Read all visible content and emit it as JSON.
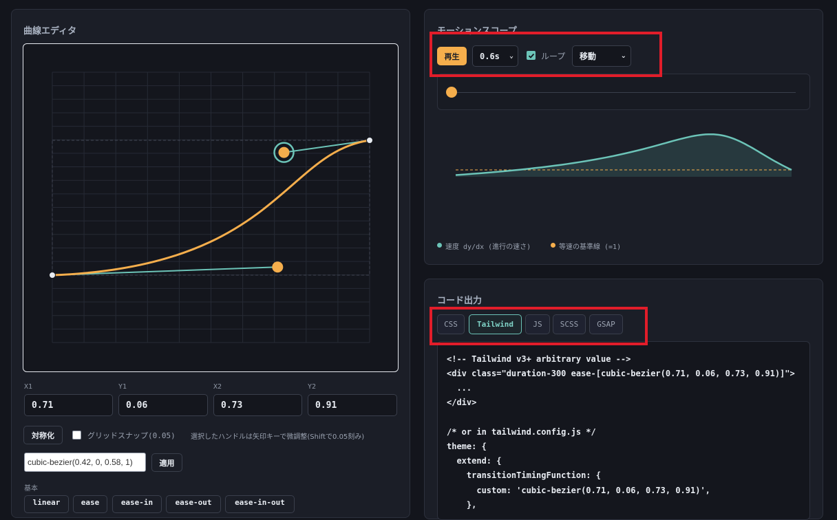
{
  "editor": {
    "title": "曲線エディタ",
    "fields": [
      {
        "label": "X1",
        "value": "0.71"
      },
      {
        "label": "Y1",
        "value": "0.06"
      },
      {
        "label": "X2",
        "value": "0.73"
      },
      {
        "label": "Y2",
        "value": "0.91"
      }
    ],
    "symmetrize_label": "対称化",
    "grid_snap_label": "グリッドスナップ(0.05)",
    "grid_snap_checked": false,
    "hint": "選択したハンドルは矢印キーで微調整(Shiftで0.05刻み)",
    "bezier_input_value": "cubic-bezier(0.42, 0, 0.58, 1)",
    "apply_label": "適用",
    "presets_section_label": "基本",
    "presets": [
      "linear",
      "ease",
      "ease-in",
      "ease-out",
      "ease-in-out"
    ],
    "curve": {
      "x1": 0.71,
      "y1": 0.06,
      "x2": 0.73,
      "y2": 0.91
    },
    "colors": {
      "curve": "#f5ae4c",
      "handle": "#6cc4b8"
    }
  },
  "scope": {
    "title": "モーションスコープ",
    "play_label": "再生",
    "duration_value": "0.6s",
    "loop_label": "ループ",
    "loop_checked": true,
    "mode_value": "移動",
    "progress": 0,
    "legend": [
      {
        "label": "速度 dy/dx (進行の速さ)",
        "color": "#6cc4b8"
      },
      {
        "label": "等速の基準線 (=1)",
        "color": "#f5ae4c"
      }
    ]
  },
  "code": {
    "title": "コード出力",
    "tabs": [
      {
        "label": "CSS",
        "active": false
      },
      {
        "label": "Tailwind",
        "active": true
      },
      {
        "label": "JS",
        "active": false
      },
      {
        "label": "SCSS",
        "active": false
      },
      {
        "label": "GSAP",
        "active": false
      }
    ],
    "lines": [
      "<!-- Tailwind v3+ arbitrary value -->",
      "<div class=\"duration-300 ease-[cubic-bezier(0.71, 0.06, 0.73, 0.91)]\">",
      "  ...",
      "</div>",
      "",
      "/* or in tailwind.config.js */",
      "theme: {",
      "  extend: {",
      "    transitionTimingFunction: {",
      "      custom: 'cubic-bezier(0.71, 0.06, 0.73, 0.91)',",
      "    },"
    ]
  }
}
